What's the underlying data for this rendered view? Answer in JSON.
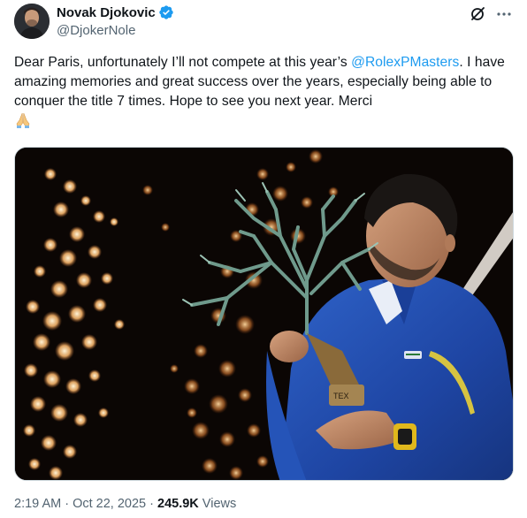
{
  "author": {
    "display_name": "Novak Djokovic",
    "handle": "@DjokerNole",
    "verified": true,
    "avatar_icon": "avatar-photo"
  },
  "header_actions": [
    {
      "icon": "grok-icon"
    },
    {
      "icon": "more-options-icon"
    }
  ],
  "tweet": {
    "text_before_mention": "Dear Paris, unfortunately I’ll not compete at this year’s ",
    "mention": "@RolexPMasters",
    "text_after_mention": ". I have amazing memories and great success over the years, especially being able to conquer the title 7 times. Hope to see you next year. Merci",
    "emoji_icon": "folded-hands-emoji"
  },
  "media": {
    "description_icon": "photo-trophy-kiss"
  },
  "meta": {
    "time": "2:19 AM",
    "separator": " · ",
    "date": "Oct 22, 2025",
    "separator2": " · ",
    "views_count": "245.9K",
    "views_label": " Views"
  },
  "colors": {
    "link": "#1d9bf0",
    "text": "#0f1419",
    "muted": "#536471",
    "verified": "#1d9bf0"
  }
}
